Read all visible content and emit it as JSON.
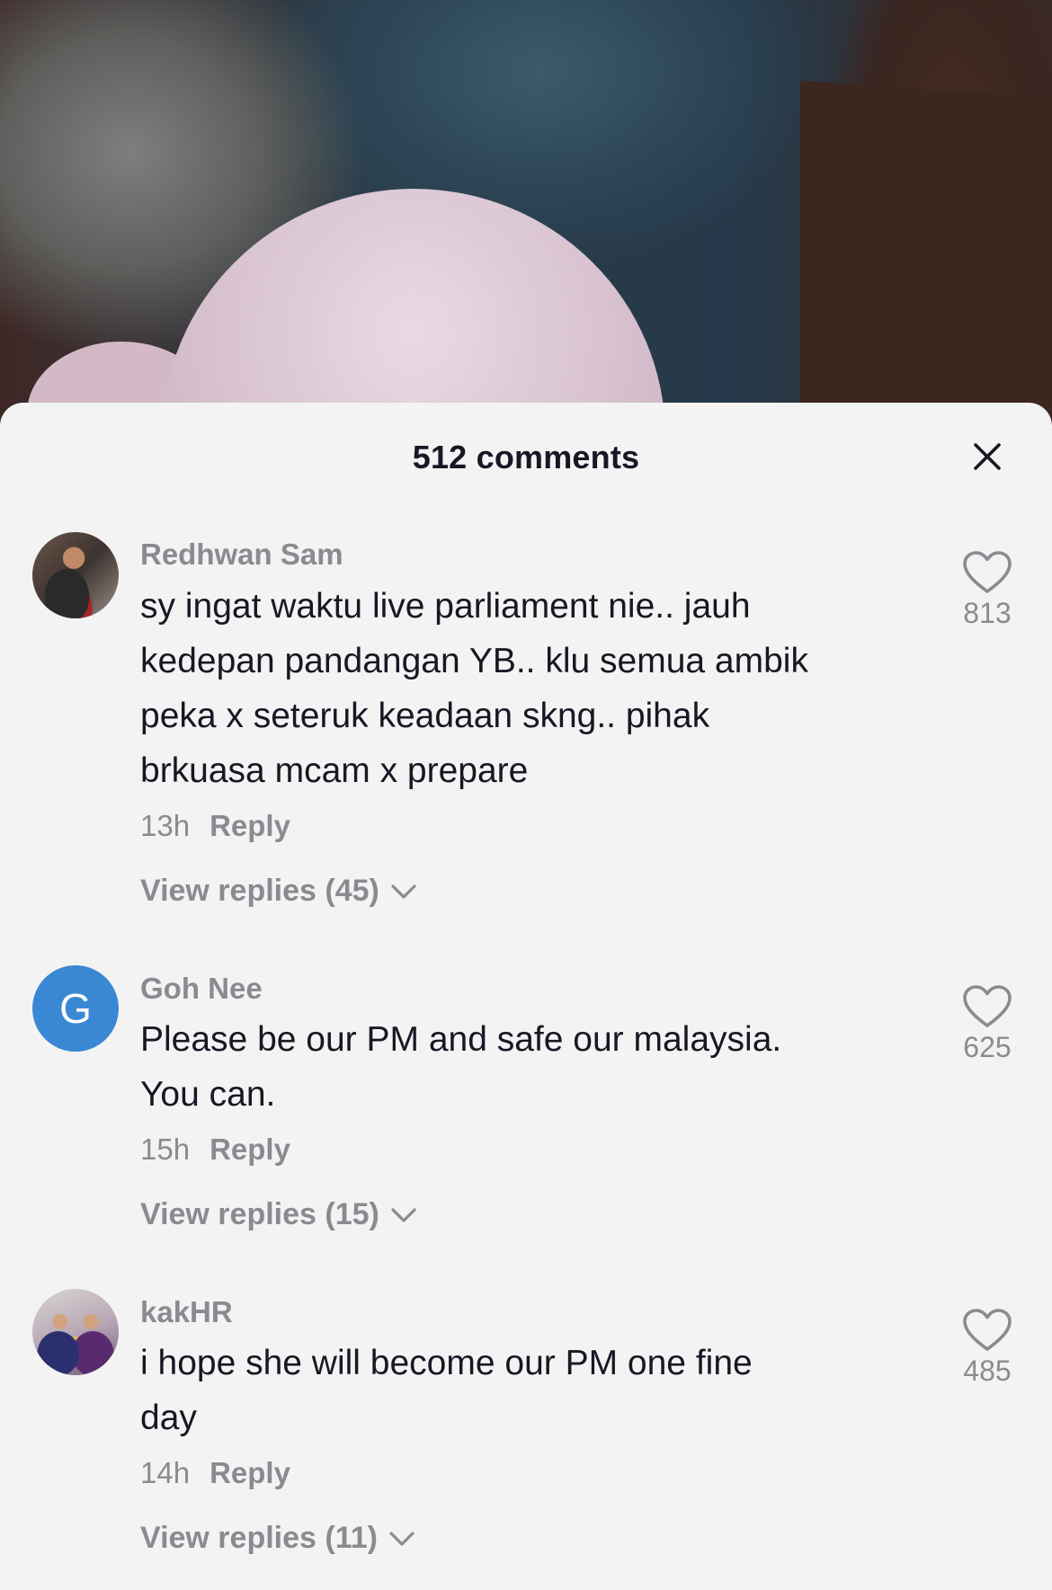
{
  "header": {
    "title": "512 comments"
  },
  "icons": {
    "close": "close-icon",
    "like": "heart-outline-icon",
    "expand": "chevron-down-icon"
  },
  "colors": {
    "sheet_bg": "#f3f3f3",
    "text_primary": "#161823",
    "text_secondary": "#8a8b91",
    "avatar_letter_bg": "#3a88d3"
  },
  "comments": [
    {
      "username": "Redhwan Sam",
      "text_lines": [
        "sy ingat waktu live parliament nie.. jauh",
        "kedepan pandangan YB.. klu semua ambik",
        "peka x seteruk keadaan skng.. pihak",
        "brkuasa mcam x prepare"
      ],
      "time": "13h",
      "reply_label": "Reply",
      "view_replies": "View replies (45)",
      "likes": "813"
    },
    {
      "username": "Goh Nee",
      "avatar_letter": "G",
      "text_lines": [
        "Please be our PM and safe our malaysia.",
        "You can."
      ],
      "time": "15h",
      "reply_label": "Reply",
      "view_replies": "View replies (15)",
      "likes": "625"
    },
    {
      "username": "kakHR",
      "text_lines": [
        "i hope she will become our PM one fine",
        "day"
      ],
      "time": "14h",
      "reply_label": "Reply",
      "view_replies": "View replies (11)",
      "likes": "485"
    }
  ]
}
